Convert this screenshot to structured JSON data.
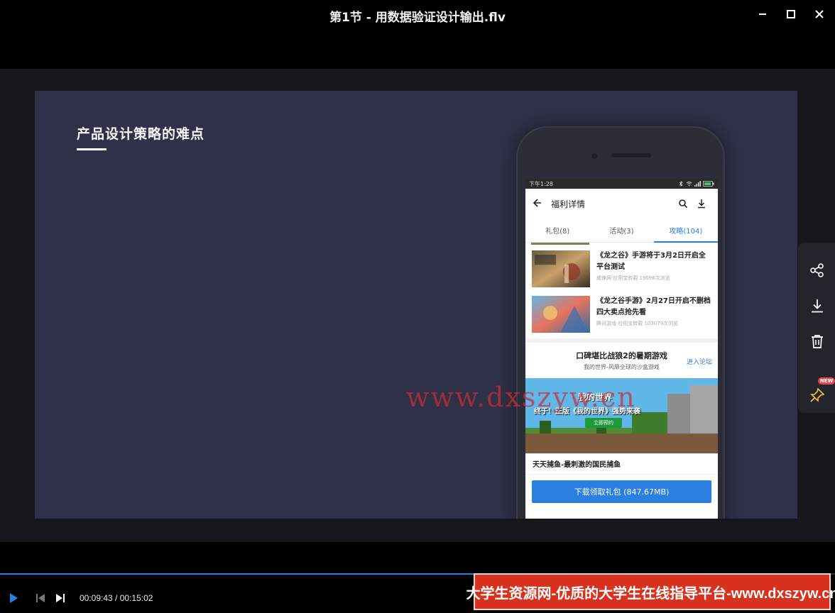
{
  "window": {
    "title": "第1节 - 用数据验证设计输出.flv"
  },
  "slide": {
    "title": "产品设计策略的难点"
  },
  "phone": {
    "status_time": "下午1:28",
    "app_title": "福利详情",
    "tabs": [
      {
        "label": "礼包(8)",
        "active": false
      },
      {
        "label": "活动(3)",
        "active": false
      },
      {
        "label": "攻略(104)",
        "active": true
      }
    ],
    "articles": [
      {
        "title": "《龙之谷》手游将于3月2日开启全平台测试",
        "meta": "威锋网·应用宝转载    19096次浏览"
      },
      {
        "title": "《龙之谷手游》2月27日开启不删档 四大卖点抢先看",
        "meta": "腾讯游戏·应用宝转载    103079次浏览"
      }
    ],
    "promo": {
      "title": "口碑堪比战狼2的暑期游戏",
      "subtitle": "我的世界-风靡全球的沙盒游戏",
      "link": "进入论坛"
    },
    "banner": {
      "logo": "我的世界",
      "headline": "终于！正版《我的世界》强势来袭",
      "button": "立即预约"
    },
    "game_title": "天天捕鱼-最刺激的国民捕鱼",
    "download_button": "下载领取礼包 (847.67MB)"
  },
  "watermark": "www.dxszyw.cn",
  "side_panel": {
    "icons": [
      "share-icon",
      "download-icon",
      "trash-icon",
      "pin-icon"
    ],
    "badge": "NEW"
  },
  "player": {
    "current_time": "00:09:43",
    "total_time": "00:15:02",
    "time_display": "00:09:43 / 00:15:02",
    "progress": 0.646,
    "accent_color": "#2a7fe0"
  },
  "ad_banner": {
    "text": "大学生资源网-优质的大学生在线指导平台-www.dxszyw.cn"
  }
}
